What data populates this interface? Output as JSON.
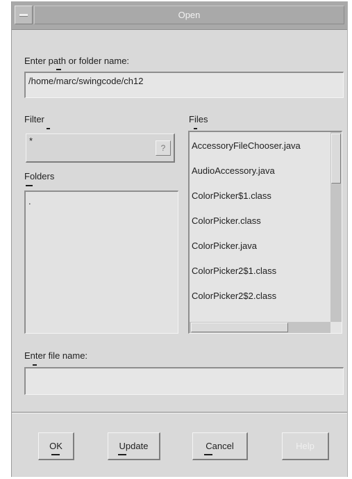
{
  "window": {
    "title": "Open"
  },
  "path": {
    "label": "Enter path or folder name:",
    "value": "/home/marc/swingcode/ch12"
  },
  "filter": {
    "label": "Filter",
    "value": "*",
    "button_glyph": "?"
  },
  "folders": {
    "label": "Folders",
    "items": [
      "."
    ]
  },
  "files": {
    "label": "Files",
    "items": [
      "AccessoryFileChooser.java",
      "AudioAccessory.java",
      "ColorPicker$1.class",
      "ColorPicker.class",
      "ColorPicker.java",
      "ColorPicker2$1.class",
      "ColorPicker2$2.class"
    ]
  },
  "filename": {
    "label": "Enter file name:",
    "value": ""
  },
  "buttons": {
    "ok": "OK",
    "update": "Update",
    "cancel": "Cancel",
    "help": "Help"
  },
  "icons": {
    "system_menu": "window-menu-icon",
    "filter_button": "filter-button-icon"
  }
}
